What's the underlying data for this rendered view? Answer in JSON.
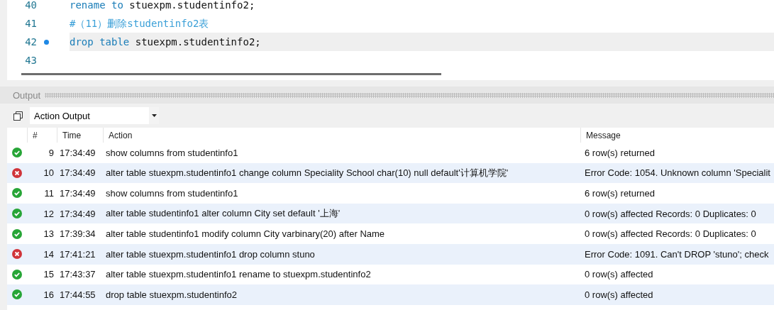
{
  "editor": {
    "lines": [
      {
        "number": "40",
        "current": false,
        "marker": false,
        "tokens": [
          {
            "kind": "keyword",
            "text": "rename"
          },
          {
            "kind": "keyword",
            "text": "to"
          },
          {
            "kind": "plain",
            "text": "stuexpm.studentinfo2;"
          }
        ]
      },
      {
        "number": "41",
        "current": false,
        "marker": false,
        "tokens": [
          {
            "kind": "comment",
            "text": "#（11）删除studentinfo2表"
          }
        ]
      },
      {
        "number": "42",
        "current": true,
        "marker": true,
        "tokens": [
          {
            "kind": "keyword",
            "text": "drop"
          },
          {
            "kind": "keyword",
            "text": "table"
          },
          {
            "kind": "plain",
            "text": "stuexpm.studentinfo2;"
          }
        ]
      },
      {
        "number": "43",
        "current": false,
        "marker": false
      }
    ]
  },
  "output": {
    "title": "Output",
    "view": "Action Output",
    "columns": [
      "#",
      "Time",
      "Action",
      "Message"
    ],
    "rows": [
      {
        "success": true,
        "number": "9",
        "time": "17:34:49",
        "action": "show columns from studentinfo1",
        "message": "6 row(s) returned"
      },
      {
        "success": false,
        "number": "10",
        "time": "17:34:49",
        "action": "alter table stuexpm.studentinfo1 change column Speciality School char(10) null default'计算机学院'",
        "message": "Error Code: 1054. Unknown column 'Specialit"
      },
      {
        "success": true,
        "number": "11",
        "time": "17:34:49",
        "action": "show columns from studentinfo1",
        "message": "6 row(s) returned"
      },
      {
        "success": true,
        "number": "12",
        "time": "17:34:49",
        "action": "alter table studentinfo1 alter column City set default '上海'",
        "message": "0 row(s) affected Records: 0  Duplicates: 0"
      },
      {
        "success": true,
        "number": "13",
        "time": "17:39:34",
        "action": "alter table studentinfo1 modify column City varbinary(20) after Name",
        "message": "0 row(s) affected Records: 0  Duplicates: 0"
      },
      {
        "success": false,
        "number": "14",
        "time": "17:41:21",
        "action": "alter table stuexpm.studentinfo1 drop column stuno",
        "message": "Error Code: 1091. Can't DROP 'stuno'; check"
      },
      {
        "success": true,
        "number": "15",
        "time": "17:43:37",
        "action": "alter table stuexpm.studentinfo1 rename to stuexpm.studentinfo2",
        "message": "0 row(s) affected"
      },
      {
        "success": true,
        "number": "16",
        "time": "17:44:55",
        "action": "drop table stuexpm.studentinfo2",
        "message": "0 row(s) affected"
      }
    ]
  }
}
